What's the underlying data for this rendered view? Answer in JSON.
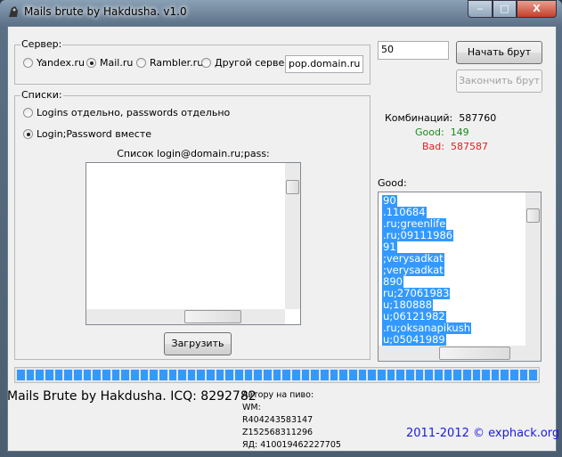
{
  "window": {
    "title": "Mails brute by Hakdusha. v1.0",
    "minimize": "‒",
    "maximize": "□",
    "close": "X"
  },
  "server": {
    "legend": "Сервер:",
    "options": [
      "Yandex.ru",
      "Mail.ru",
      "Rambler.ru",
      "Другой сервер:"
    ],
    "selected": 1,
    "custom_value": "pop.domain.ru"
  },
  "threads": {
    "value": "50"
  },
  "buttons": {
    "start": "Начать брут",
    "stop": "Закончить брут",
    "load": "Загрузить"
  },
  "lists": {
    "legend": "Списки:",
    "options": [
      "Logins отдельно, passwords отдельно",
      "Login;Password вместе"
    ],
    "selected": 1,
    "textarea_label": "Список login@domain.ru;pass:",
    "textarea_value": ""
  },
  "stats": {
    "combinations_label": "Комбинаций:",
    "combinations": "587760",
    "good_label": "Good:",
    "good": "149",
    "bad_label": "Bad:",
    "bad": "587587",
    "good_color": "#1a8a1a",
    "bad_color": "#e02020"
  },
  "good_list": {
    "label": "Good:",
    "items": [
      "90",
      ".110684",
      ".ru;greenlife",
      ".ru;09111986",
      "91",
      ";verysadkat",
      ";verysadkat",
      "890",
      "ru;27061983",
      "u;180888",
      "u;06121982",
      ".ru;oksanapikush",
      "u;05041989"
    ]
  },
  "progress": {
    "percent": 100
  },
  "footer": {
    "credit": "Mails Brute by Hakdusha. ICQ: 8292782",
    "donate_title": "Автору на пиво:",
    "wm_label": "WM:",
    "wmr": "R404243583147",
    "wmz": "Z152568311296",
    "yd": "ЯД: 410019462227705",
    "copyright": "2011-2012 © exphack.org"
  }
}
